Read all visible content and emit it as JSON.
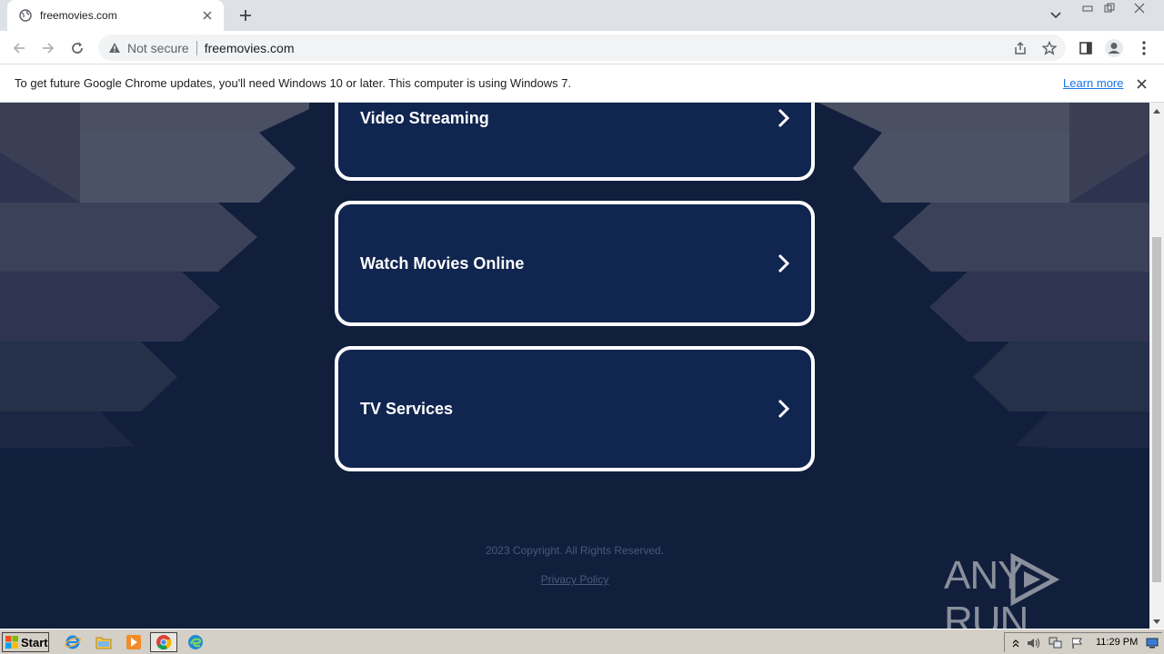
{
  "browser": {
    "tab": {
      "title": "freemovies.com"
    },
    "address": {
      "security_label": "Not secure",
      "url": "freemovies.com"
    },
    "infobar": {
      "message": "To get future Google Chrome updates, you'll need Windows 10 or later. This computer is using Windows 7.",
      "link_label": "Learn more"
    }
  },
  "page": {
    "cards": [
      {
        "label": "Video Streaming"
      },
      {
        "label": "Watch Movies Online"
      },
      {
        "label": "TV Services"
      }
    ],
    "copyright": "2023 Copyright. All Rights Reserved.",
    "privacy_label": "Privacy Policy",
    "watermark": "ANY RUN"
  },
  "taskbar": {
    "start_label": "Start",
    "clock": "11:29 PM"
  },
  "colors": {
    "page_bg": "#111f3d",
    "card_bg": "#10254f",
    "link_blue": "#1a73e8"
  }
}
